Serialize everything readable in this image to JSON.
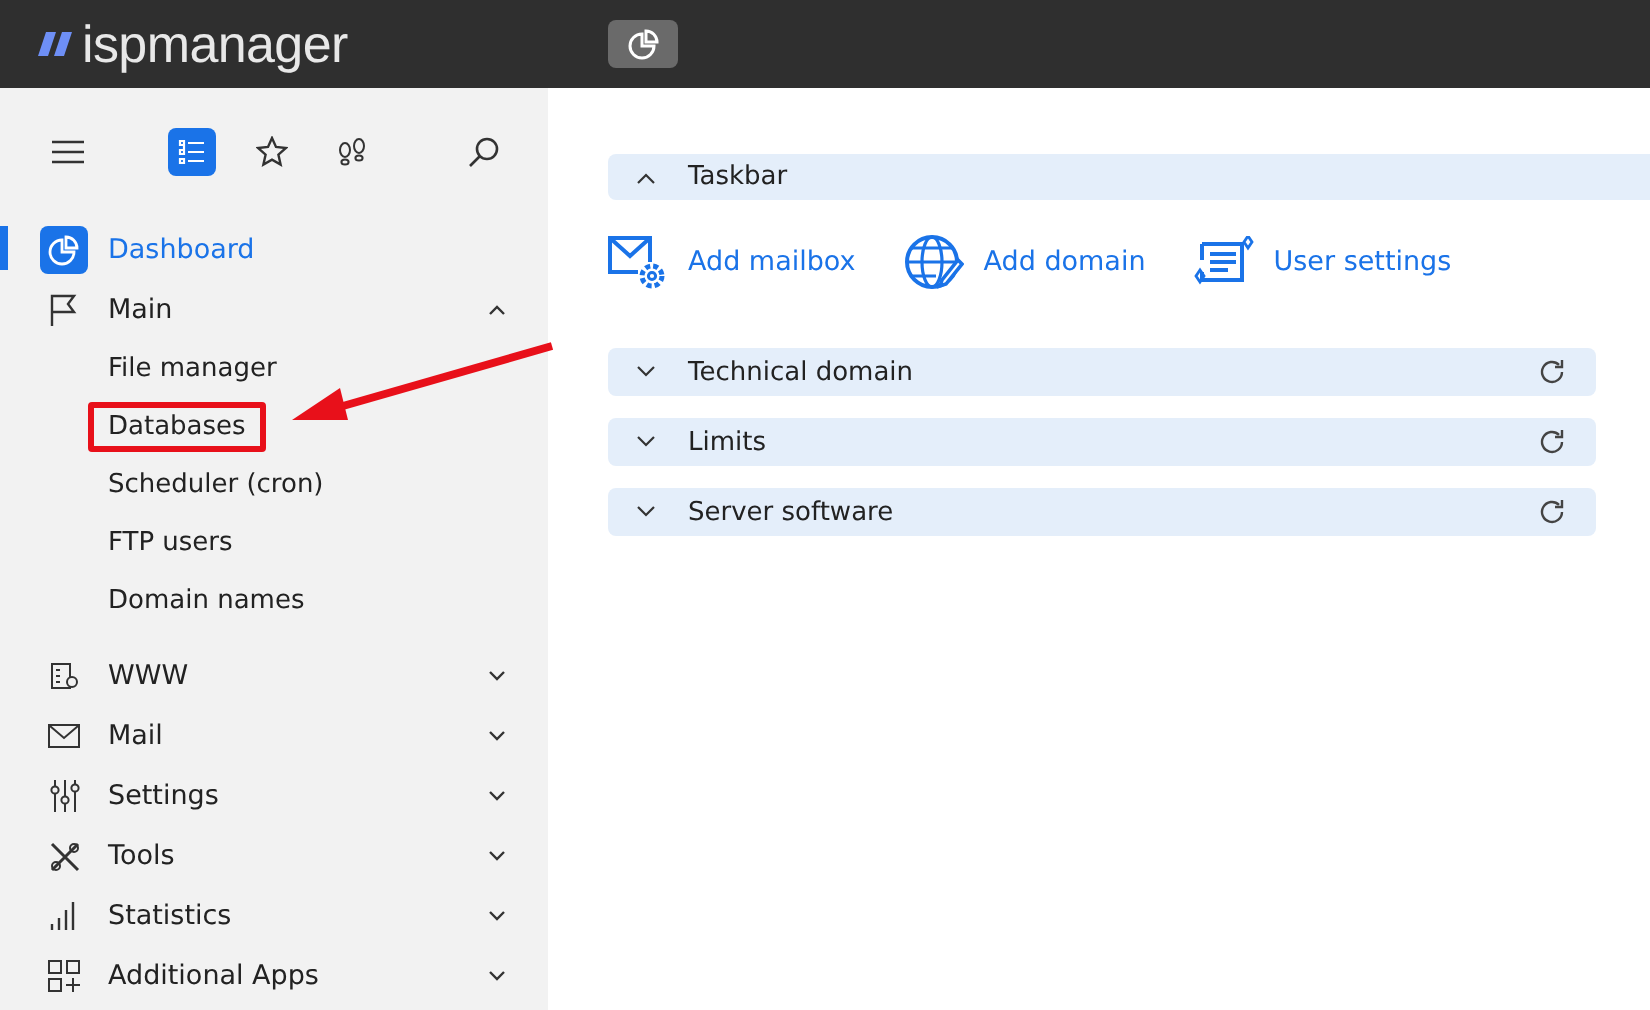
{
  "header": {
    "logo": "ispmanager"
  },
  "sidebar": {
    "items": [
      {
        "label": "Dashboard",
        "selected": true
      },
      {
        "label": "Main",
        "selected": false,
        "expanded": true,
        "children": [
          {
            "label": "File manager",
            "highlighted": false
          },
          {
            "label": "Databases",
            "highlighted": true
          },
          {
            "label": "Scheduler (cron)",
            "highlighted": false
          },
          {
            "label": "FTP users",
            "highlighted": false
          },
          {
            "label": "Domain names",
            "highlighted": false
          }
        ]
      },
      {
        "label": "WWW",
        "selected": false,
        "expanded": false
      },
      {
        "label": "Mail",
        "selected": false,
        "expanded": false
      },
      {
        "label": "Settings",
        "selected": false,
        "expanded": false
      },
      {
        "label": "Tools",
        "selected": false,
        "expanded": false
      },
      {
        "label": "Statistics",
        "selected": false,
        "expanded": false
      },
      {
        "label": "Additional Apps",
        "selected": false,
        "expanded": false
      }
    ]
  },
  "sections": [
    {
      "title": "Taskbar",
      "expanded": true,
      "tasks": [
        {
          "label": "Add mailbox"
        },
        {
          "label": "Add domain"
        },
        {
          "label": "User settings"
        }
      ]
    },
    {
      "title": "Technical domain",
      "expanded": false
    },
    {
      "title": "Limits",
      "expanded": false
    },
    {
      "title": "Server software",
      "expanded": false
    }
  ]
}
